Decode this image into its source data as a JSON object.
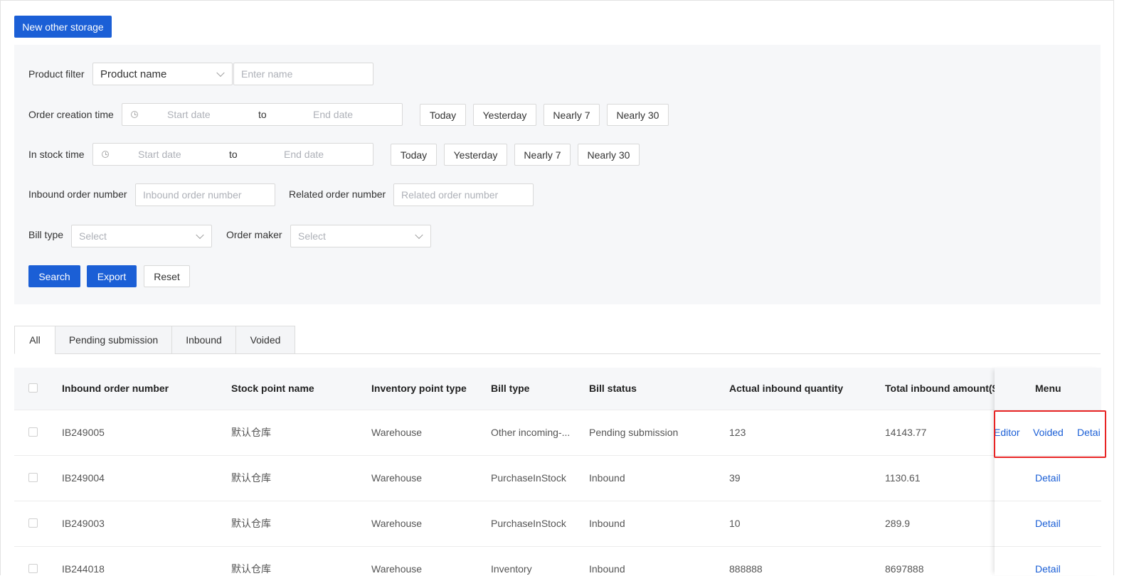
{
  "toolbar": {
    "new_button": "New other storage"
  },
  "filters": {
    "product_filter_label": "Product filter",
    "product_filter_select": "Product name",
    "product_name_placeholder": "Enter name",
    "order_creation_label": "Order creation time",
    "in_stock_label": "In stock time",
    "start_placeholder": "Start date",
    "range_sep": "to",
    "end_placeholder": "End date",
    "quick_ranges": [
      "Today",
      "Yesterday",
      "Nearly 7",
      "Nearly 30"
    ],
    "inbound_order_label": "Inbound order number",
    "inbound_order_placeholder": "Inbound order number",
    "related_order_label": "Related order number",
    "related_order_placeholder": "Related order number",
    "bill_type_label": "Bill type",
    "bill_type_placeholder": "Select",
    "order_maker_label": "Order maker",
    "order_maker_placeholder": "Select",
    "search": "Search",
    "export": "Export",
    "reset": "Reset"
  },
  "tabs": [
    {
      "label": "All",
      "active": true
    },
    {
      "label": "Pending submission",
      "active": false
    },
    {
      "label": "Inbound",
      "active": false
    },
    {
      "label": "Voided",
      "active": false
    }
  ],
  "table": {
    "columns": [
      "Inbound order number",
      "Stock point name",
      "Inventory point type",
      "Bill type",
      "Bill status",
      "Actual inbound quantity",
      "Total inbound amount($",
      "Menu"
    ],
    "rows": [
      {
        "order": "IB249005",
        "stock_point": "默认仓库",
        "point_type": "Warehouse",
        "bill_type": "Other incoming-...",
        "status": "Pending submission",
        "qty": "123",
        "amount": "14143.77",
        "actions": [
          "Editor",
          "Voided",
          "Detai"
        ]
      },
      {
        "order": "IB249004",
        "stock_point": "默认仓库",
        "point_type": "Warehouse",
        "bill_type": "PurchaseInStock",
        "status": "Inbound",
        "qty": "39",
        "amount": "1130.61",
        "actions": [
          "Detail"
        ]
      },
      {
        "order": "IB249003",
        "stock_point": "默认仓库",
        "point_type": "Warehouse",
        "bill_type": "PurchaseInStock",
        "status": "Inbound",
        "qty": "10",
        "amount": "289.9",
        "actions": [
          "Detail"
        ]
      },
      {
        "order": "IB244018",
        "stock_point": "默认仓库",
        "point_type": "Warehouse",
        "bill_type": "Inventory",
        "status": "Inbound",
        "qty": "888888",
        "amount": "8697888",
        "actions": [
          "Detail"
        ]
      }
    ]
  },
  "colors": {
    "primary": "#1b5fd6",
    "highlight": "#e82424",
    "panel_bg": "#f6f7f9"
  }
}
